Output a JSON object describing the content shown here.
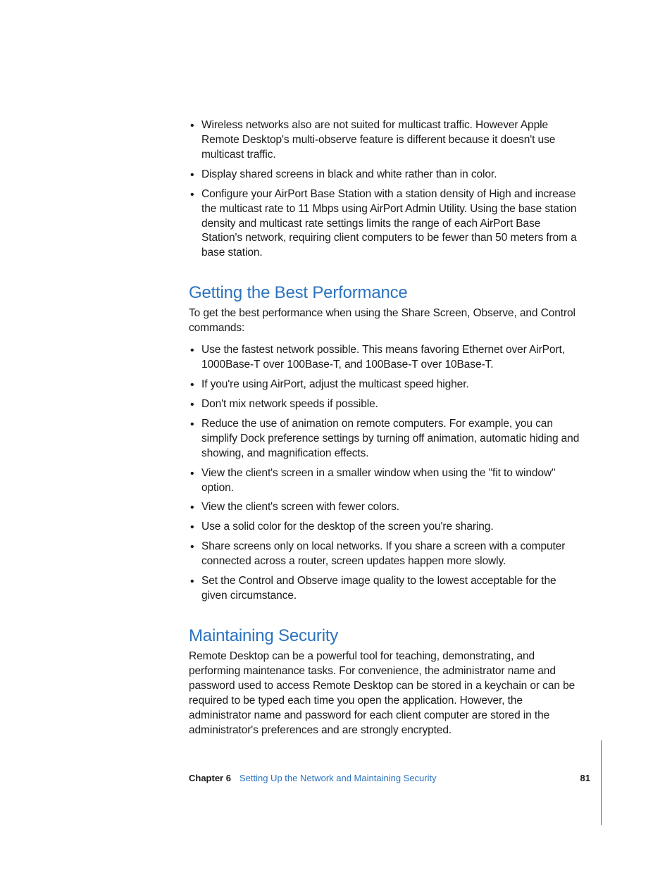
{
  "topList": [
    "Wireless networks also are not suited for multicast traffic. However Apple Remote Desktop's multi-observe feature is different because it doesn't use multicast traffic.",
    "Display shared screens in black and white rather than in color.",
    "Configure your AirPort Base Station with a station density of High and increase the multicast rate to 11 Mbps using AirPort Admin Utility. Using the base station density and multicast rate settings limits the range of each AirPort Base Station's network, requiring client computers to be fewer than 50 meters from a base station."
  ],
  "section1": {
    "heading": "Getting the Best Performance",
    "intro": "To get the best performance when using the Share Screen, Observe, and Control commands:",
    "bullets": [
      "Use the fastest network possible. This means favoring Ethernet over AirPort, 1000Base-T over 100Base-T, and 100Base-T over 10Base-T.",
      "If you're using AirPort, adjust the multicast speed higher.",
      "Don't mix network speeds if possible.",
      "Reduce the use of animation on remote computers. For example, you can simplify Dock preference settings by turning off animation, automatic hiding and showing, and magnification effects.",
      "View the client's screen in a smaller window when using the \"fit to window\" option.",
      "View the client's screen with fewer colors.",
      "Use a solid color for the desktop of the screen you're sharing.",
      "Share screens only on local networks. If you share a screen with a computer connected across a router, screen updates happen more slowly.",
      "Set the Control and Observe image quality to the lowest acceptable for the given circumstance."
    ]
  },
  "section2": {
    "heading": "Maintaining Security",
    "intro": "Remote Desktop can be a powerful tool for teaching, demonstrating, and performing maintenance tasks. For convenience, the administrator name and password used to access Remote Desktop can be stored in a keychain or can be required to be typed each time you open the application. However, the administrator name and password for each client computer are stored in the administrator's preferences and are strongly encrypted."
  },
  "footer": {
    "chapterLabel": "Chapter 6",
    "chapterTitle": "Setting Up the Network and Maintaining Security",
    "pageNum": "81"
  }
}
